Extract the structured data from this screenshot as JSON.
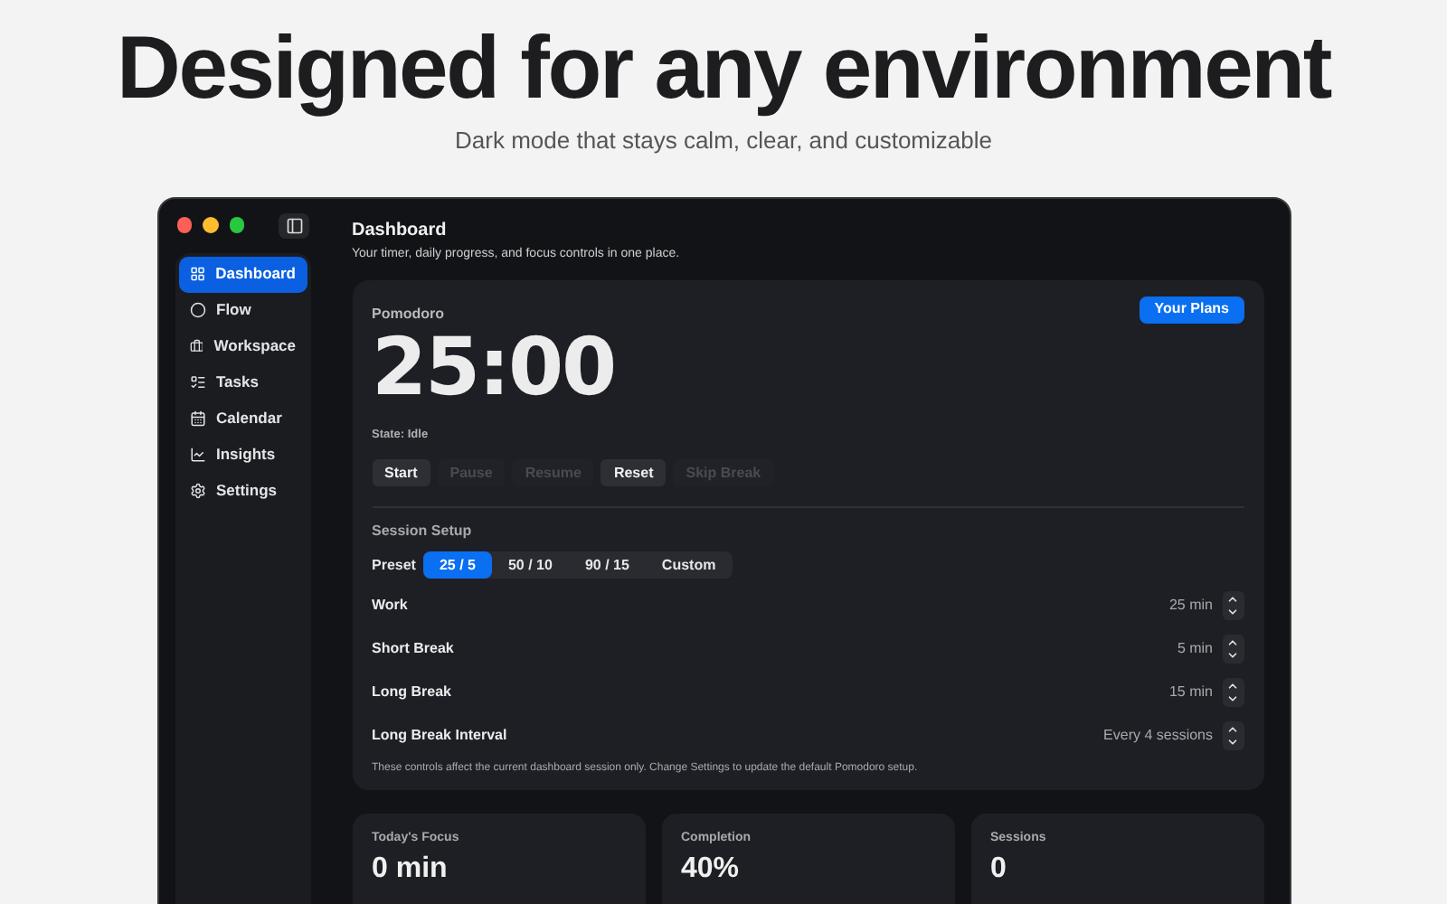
{
  "hero": {
    "title": "Designed for any environment",
    "subtitle": "Dark mode that stays calm, clear, and customizable"
  },
  "sidebar": {
    "items": [
      {
        "label": "Dashboard",
        "selected": true
      },
      {
        "label": "Flow",
        "selected": false
      },
      {
        "label": "Workspace",
        "selected": false
      },
      {
        "label": "Tasks",
        "selected": false
      },
      {
        "label": "Calendar",
        "selected": false
      },
      {
        "label": "Insights",
        "selected": false
      },
      {
        "label": "Settings",
        "selected": false
      }
    ]
  },
  "header": {
    "title": "Dashboard",
    "subtitle": "Your timer, daily progress, and focus controls in one place."
  },
  "pomodoro": {
    "title": "Pomodoro",
    "plans_button": "Your Plans",
    "time": "25:00",
    "state": "State: Idle",
    "actions": [
      {
        "label": "Start",
        "disabled": false
      },
      {
        "label": "Pause",
        "disabled": true
      },
      {
        "label": "Resume",
        "disabled": true
      },
      {
        "label": "Reset",
        "disabled": false
      },
      {
        "label": "Skip Break",
        "disabled": true
      }
    ],
    "setup_title": "Session Setup",
    "preset_label": "Preset",
    "presets": [
      {
        "label": "25 / 5",
        "selected": true
      },
      {
        "label": "50 / 10",
        "selected": false
      },
      {
        "label": "90 / 15",
        "selected": false
      },
      {
        "label": "Custom",
        "selected": false
      }
    ],
    "settings": [
      {
        "label": "Work",
        "value": "25 min"
      },
      {
        "label": "Short Break",
        "value": "5 min"
      },
      {
        "label": "Long Break",
        "value": "15 min"
      },
      {
        "label": "Long Break Interval",
        "value": "Every 4 sessions"
      }
    ],
    "note": "These controls affect the current dashboard session only. Change Settings to update the default Pomodoro setup."
  },
  "stats": [
    {
      "label": "Today's Focus",
      "value": "0 min"
    },
    {
      "label": "Completion",
      "value": "40%"
    },
    {
      "label": "Sessions",
      "value": "0"
    }
  ]
}
